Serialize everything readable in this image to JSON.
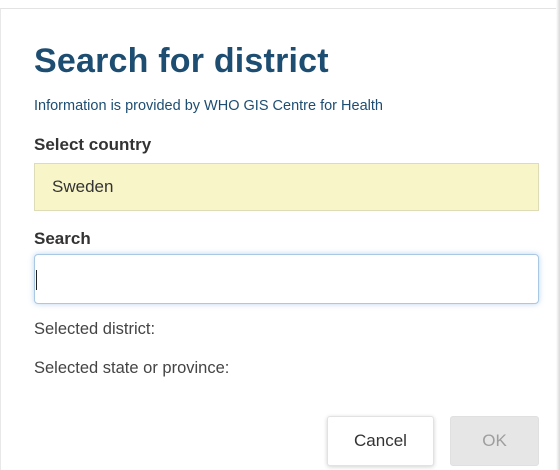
{
  "dialog": {
    "title": "Search for district",
    "info": "Information is provided by WHO GIS Centre for Health",
    "country_label": "Select country",
    "country_value": "Sweden",
    "search_label": "Search",
    "search_value": "",
    "search_placeholder": "",
    "selected_district_label": "Selected district:",
    "selected_state_label": "Selected state or province:",
    "cancel_label": "Cancel",
    "ok_label": "OK"
  },
  "colors": {
    "title": "#1d4d71",
    "country_box_bg": "#f8f5c8",
    "ok_disabled_bg": "#e6e6e6"
  }
}
